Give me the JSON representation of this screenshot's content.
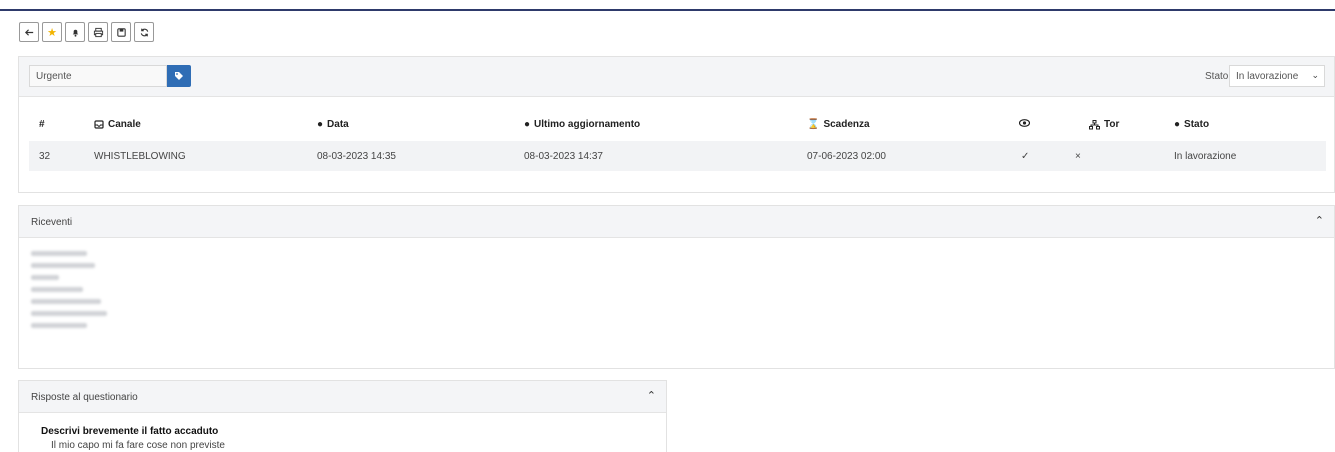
{
  "toolbar": {
    "buttons": [
      "back",
      "favorite",
      "notify",
      "print",
      "save",
      "refresh"
    ]
  },
  "filter": {
    "tag_value": "Urgente",
    "stato_label": "Stato",
    "stato_selected": "In lavorazione"
  },
  "table": {
    "headers": {
      "num": "#",
      "canale": "Canale",
      "data": "Data",
      "ultimo": "Ultimo aggiornamento",
      "scadenza": "Scadenza",
      "tor": "Tor",
      "stato": "Stato"
    },
    "row": {
      "num": "32",
      "canale": "WHISTLEBLOWING",
      "data": "08-03-2023 14:35",
      "ultimo": "08-03-2023 14:37",
      "scadenza": "07-06-2023 02:00",
      "seen": "✓",
      "tor": "×",
      "stato": "In lavorazione"
    }
  },
  "riceventi": {
    "title": "Riceventi"
  },
  "risposte": {
    "title": "Risposte al questionario",
    "question": "Descrivi brevemente il fatto accaduto",
    "answer": "Il mio capo mi fa fare cose non previste"
  },
  "colors": {
    "accent": "#2f6db5",
    "star": "#f2b400",
    "header_line": "#2e3a6b"
  }
}
